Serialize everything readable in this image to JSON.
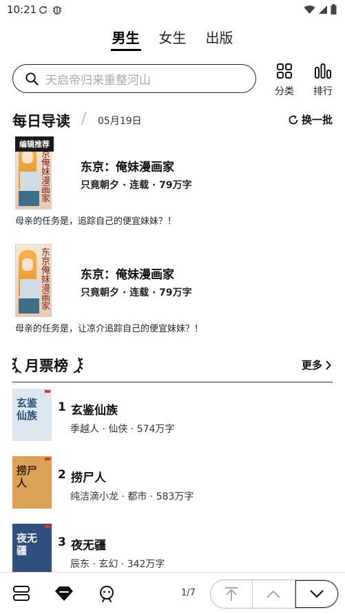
{
  "status_bar": {
    "time": "10:21"
  },
  "tabs": [
    {
      "label": "男生",
      "active": true
    },
    {
      "label": "女生",
      "active": false
    },
    {
      "label": "出版",
      "active": false
    }
  ],
  "search": {
    "placeholder": "天启帝归来重整河山"
  },
  "quick_actions": [
    {
      "label": "分类",
      "icon": "grid-icon"
    },
    {
      "label": "排行",
      "icon": "bar-chart-icon"
    }
  ],
  "daily": {
    "title": "每日导读",
    "separator": "/",
    "date": "05月19日",
    "refresh_label": "换一批",
    "books": [
      {
        "badge": "编辑推荐",
        "cover_text": "东京俺妹漫画家",
        "title": "东京：俺妹漫画家",
        "meta": "只竟朝夕 · 连载 · 79万字",
        "desc": "母亲的任务是，追踪自己的便宜妹妹？！"
      },
      {
        "badge": "",
        "cover_text": "东京俺妹漫画家",
        "title": "东京：俺妹漫画家",
        "meta": "只竟朝夕 · 连载 · 79万字",
        "desc": "母亲的任务是，让凉介追踪自己的便宜妹妹？！"
      }
    ]
  },
  "ranking": {
    "title": "月票榜",
    "more_label": "更多",
    "items": [
      {
        "rank": "1",
        "title": "玄鉴仙族",
        "meta": "季越人 · 仙侠 · 574万字",
        "cover_text": "玄鉴仙族",
        "cover_bg": "#dce6ef",
        "cover_fg": "#2a4e7a"
      },
      {
        "rank": "2",
        "title": "捞尸人",
        "meta": "纯洁滴小龙 · 都市 · 583万字",
        "cover_text": "捞尸人",
        "cover_bg": "#d9a257",
        "cover_fg": "#3a2410"
      },
      {
        "rank": "3",
        "title": "夜无疆",
        "meta": "辰东 · 玄幻 · 342万字",
        "cover_text": "夜无疆",
        "cover_bg": "#2f4f7f",
        "cover_fg": "#f1f1f1"
      }
    ]
  },
  "bottom_bar": {
    "page_indicator": "1/7"
  }
}
